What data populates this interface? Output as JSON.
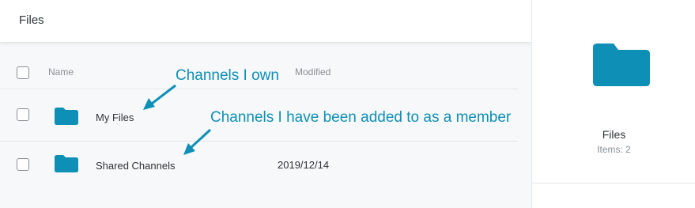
{
  "header": {
    "title": "Files"
  },
  "table": {
    "columns": {
      "name": "Name",
      "modified": "Modified"
    },
    "rows": [
      {
        "name": "My Files",
        "modified": ""
      },
      {
        "name": "Shared Channels",
        "modified": "2019/12/14"
      }
    ]
  },
  "annotations": {
    "own": "Channels I own",
    "member": "Channels I have been added to as a member"
  },
  "details": {
    "title": "Files",
    "items": "Items: 2"
  },
  "colors": {
    "accent": "#0e8fb5",
    "folder": "#0e8fb5"
  },
  "icons": {
    "folder": "folder-icon",
    "checkbox": "checkbox-icon",
    "arrow": "arrow-icon"
  }
}
